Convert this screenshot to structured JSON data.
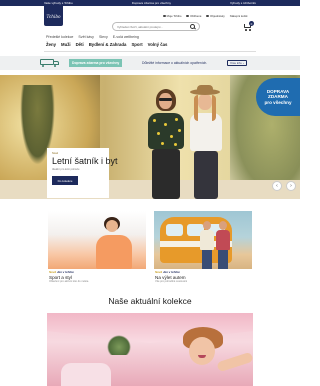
{
  "topbar": {
    "left": "Vaše výhody s Tchibo",
    "center": "Doprava zdarma pro všechny",
    "right": "Výhody s tchiboinfo"
  },
  "header": {
    "logo": "Tchibo",
    "search_placeholder": "Vyhledat zboží, aktuální prodejní...",
    "utility": [
      "Moje Tchibo",
      "Oblíbené",
      "Objednávky",
      "Nákupní košík"
    ],
    "cart_count": "0"
  },
  "secondary_nav": [
    "Předešlé kolekce",
    "Svět kávy",
    "Slevy",
    "E-volá wellbeing"
  ],
  "main_nav": [
    "Ženy",
    "Muži",
    "Děti",
    "Bydlení & Zahrada",
    "Sport",
    "Volný čas"
  ],
  "promo": {
    "tag": "Doprava zdarma pro všechny",
    "text": "Důležité informace o aktuálních opatřeních.",
    "button": "Více info"
  },
  "hero": {
    "small_label": "Nově",
    "title": "Letní šatník i byt",
    "subtitle": "Ideální pro letní pohodu",
    "button": "Do kolekce",
    "badge_lines": [
      "DOPRAVA",
      "ZDARMA",
      "pro všechny"
    ],
    "prev": "‹",
    "next": "›"
  },
  "tiles": [
    {
      "new": "Nově",
      "tagline": "Jen v tchibo",
      "title": "Sport a styl",
      "subtitle": "Oblečení pro aktivní léto do města"
    },
    {
      "new": "Nově",
      "tagline": "Jen v tchibo",
      "title": "Na výlet autem",
      "subtitle": "Vše pro pohodlné cestování"
    }
  ],
  "section_title": "Naše aktuální kolekce",
  "colors": {
    "brand_navy": "#1d2a5c",
    "promo_green": "#7bc4b4",
    "badge_blue": "#1f6cb0",
    "accent_gold": "#c9a227"
  }
}
